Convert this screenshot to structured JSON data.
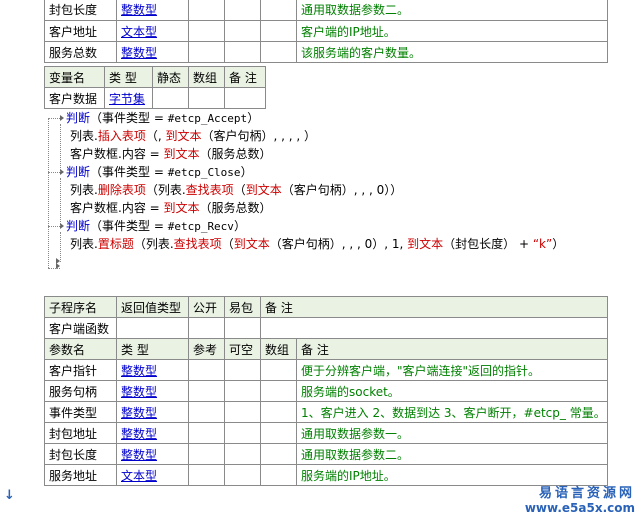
{
  "top_table": {
    "rows": [
      {
        "name": "封包长度",
        "type": "整数型",
        "note": "通用取数据参数二。"
      },
      {
        "name": "客户地址",
        "type": "文本型",
        "note": "客户端的IP地址。"
      },
      {
        "name": "服务总数",
        "type": "整数型",
        "note": "该服务端的客户数量。"
      }
    ]
  },
  "var_table": {
    "headers": [
      "变量名",
      "类 型",
      "静态",
      "数组",
      "备 注"
    ],
    "row": {
      "name": "客户数据",
      "type": "字节集"
    }
  },
  "code": {
    "l1": {
      "kw": "判断",
      "rest": "（事件类型 = ",
      "const": "#etcp_Accept",
      "end": "）"
    },
    "l2": {
      "a": "列表.",
      "fn": "插入表项",
      "b": "（, ",
      "fn2": "到文本",
      "c": "（客户句柄）, , , , ）"
    },
    "l3": {
      "a": "客户数框.内容 = ",
      "fn": "到文本",
      "c": "（服务总数）"
    },
    "l4": {
      "kw": "判断",
      "rest": "（事件类型 = ",
      "const": "#etcp_Close",
      "end": "）"
    },
    "l5": {
      "a": "列表.",
      "fn": "删除表项",
      "b": "（列表.",
      "fn2": "查找表项",
      "c": "（",
      "fn3": "到文本",
      "d": "（客户句柄）, , , 0））"
    },
    "l6": {
      "a": "客户数框.内容 = ",
      "fn": "到文本",
      "c": "（服务总数）"
    },
    "l7": {
      "kw": "判断",
      "rest": "（事件类型 = ",
      "const": "#etcp_Recv",
      "end": "）"
    },
    "l8": {
      "a": "列表.",
      "fn": "置标题",
      "b": "（列表.",
      "fn2": "查找表项",
      "c": "（",
      "fn3": "到文本",
      "d": "（客户句柄）, , , 0）, 1, ",
      "fn4": "到文本",
      "e": "（封包长度） + ",
      "str": "“k”",
      "f": "）"
    }
  },
  "sub_table": {
    "headers": [
      "子程序名",
      "返回值类型",
      "公开",
      "易包",
      "备 注"
    ],
    "name": "客户端函数",
    "param_headers": [
      "参数名",
      "类 型",
      "参考",
      "可空",
      "数组",
      "备 注"
    ],
    "params": [
      {
        "name": "客户指针",
        "type": "整数型",
        "note": "便于分辨客户端，\"客户端连接\"返回的指针。"
      },
      {
        "name": "服务句柄",
        "type": "整数型",
        "note": "服务端的socket。"
      },
      {
        "name": "事件类型",
        "type": "整数型",
        "note": "1、客户进入 2、数据到达 3、客户断开，#etcp_ 常量。"
      },
      {
        "name": "封包地址",
        "type": "整数型",
        "note": "通用取数据参数一。"
      },
      {
        "name": "封包长度",
        "type": "整数型",
        "note": "通用取数据参数二。"
      },
      {
        "name": "服务地址",
        "type": "文本型",
        "note": "服务端的IP地址。"
      }
    ]
  },
  "watermark": {
    "line1": "易语言资源网",
    "line2": "www.e5a5x.com"
  },
  "colors": {
    "header_bg": "#eaf2e4",
    "type_blue": "#0000cc",
    "note_green": "#008000",
    "func_red": "#cc0000"
  }
}
